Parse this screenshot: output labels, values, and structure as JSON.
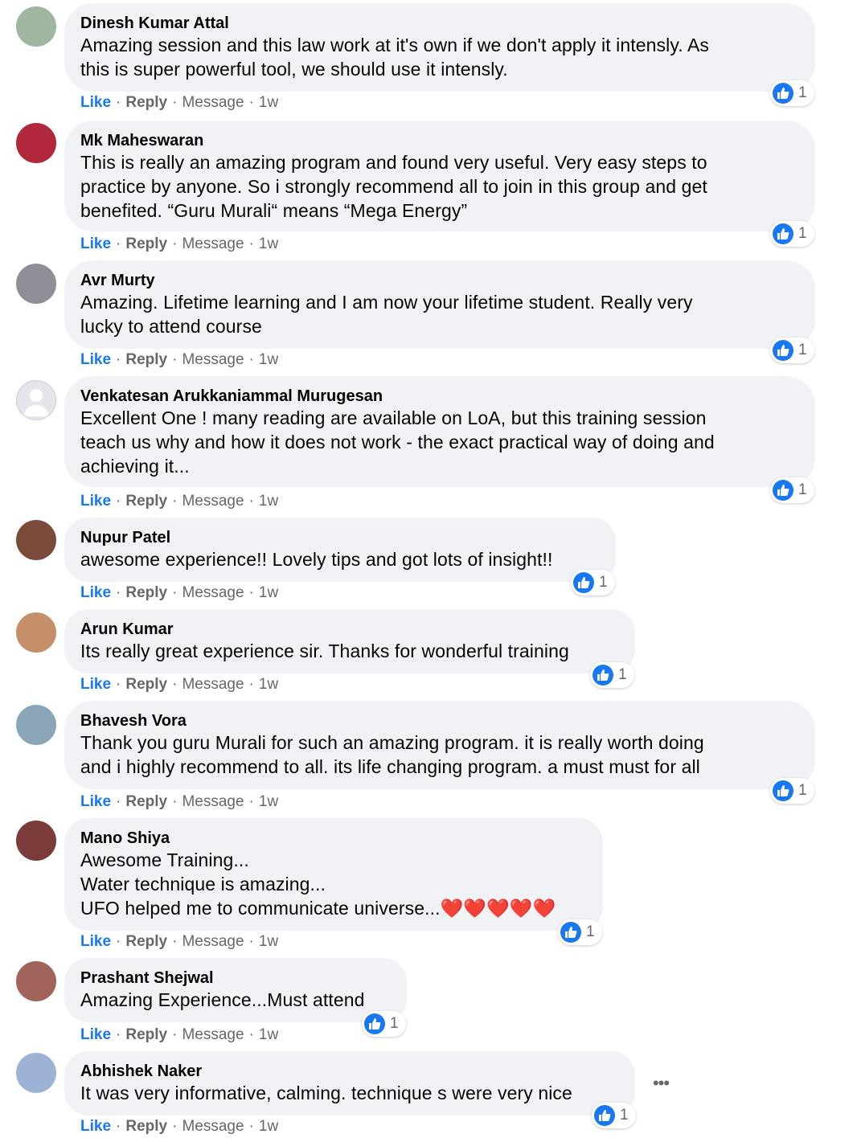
{
  "action_labels": {
    "like": "Like",
    "reply": "Reply",
    "message": "Message"
  },
  "comments": [
    {
      "author": "Dinesh Kumar Attal",
      "text": "Amazing session and this law work at it's own if we don't apply it intensly. As\nthis is super powerful tool, we should use it intensly.",
      "time": "1w",
      "reactions": "1",
      "avatar_color": "#9fb7a0"
    },
    {
      "author": "Mk Maheswaran",
      "text": "This is really an amazing program and found very useful. Very easy steps to\npractice by anyone. So i strongly recommend all to join in this group and get\nbenefited. “Guru Murali“ means “Mega Energy”",
      "time": "1w",
      "reactions": "1",
      "avatar_color": "#b0283a"
    },
    {
      "author": "Avr Murty",
      "text": "Amazing. Lifetime learning and I am now your lifetime student. Really very\nlucky to attend course",
      "time": "1w",
      "reactions": "1",
      "avatar_color": "#8e8f96"
    },
    {
      "author": "Venkatesan Arukkaniammal Murugesan",
      "text": "Excellent One ! many reading are available on LoA, but this training session\nteach us why and how it does not work - the exact practical way of doing and\nachieving it...",
      "time": "1w",
      "reactions": "1",
      "avatar_color": "#dfe1e5"
    },
    {
      "author": "Nupur Patel",
      "text": "awesome experience!! Lovely tips and got lots of insight!!",
      "time": "1w",
      "reactions": "1",
      "avatar_color": "#7a4a3a"
    },
    {
      "author": "Arun Kumar",
      "text": "Its really great experience sir. Thanks for wonderful training",
      "time": "1w",
      "reactions": "1",
      "avatar_color": "#c58f6a"
    },
    {
      "author": "Bhavesh Vora",
      "text": "Thank you guru Murali for such an amazing program. it is really worth doing\nand i highly recommend to all. its life changing program. a must must for all",
      "time": "1w",
      "reactions": "1",
      "avatar_color": "#8aa5b8"
    },
    {
      "author": "Mano Shiya",
      "text": "Awesome Training...\nWater technique is amazing...\nUFO helped me to communicate universe...",
      "hearts": "❤️❤️❤️❤️❤️",
      "time": "1w",
      "reactions": "1",
      "avatar_color": "#7b3b3b"
    },
    {
      "author": "Prashant Shejwal",
      "text": "Amazing Experience...Must attend",
      "time": "1w",
      "reactions": "1",
      "avatar_color": "#a0645a"
    },
    {
      "author": "Abhishek Naker",
      "text": "It was very informative, calming. technique s were very nice",
      "time": "1w",
      "reactions": "1",
      "avatar_color": "#9db3d6"
    }
  ],
  "more_options": "•••"
}
